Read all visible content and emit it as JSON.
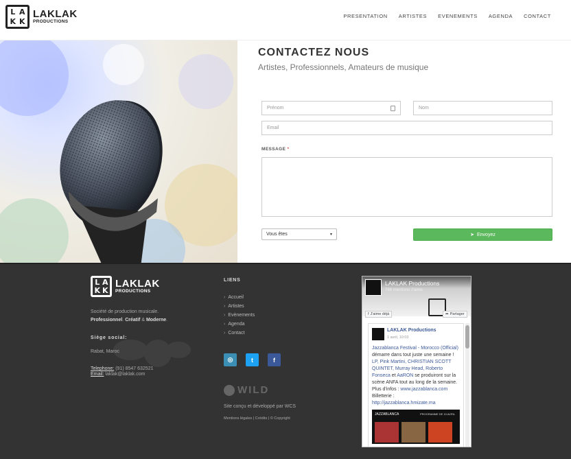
{
  "header": {
    "logo_title": "LAKLAK",
    "logo_subtitle": "PRODUCTIONS",
    "nav": [
      "PRESENTATION",
      "ARTISTES",
      "EVENEMENTS",
      "AGENDA",
      "CONTACT"
    ]
  },
  "contact": {
    "title": "CONTACTEZ NOUS",
    "subtitle": "Artistes, Professionnels, Amateurs de musique",
    "prenom_placeholder": "Prénom",
    "nom_placeholder": "Nom",
    "email_placeholder": "Email",
    "message_label": "MESSAGE",
    "message_required": "*",
    "select_value": "Vous êtes",
    "send_label": "Envoyez"
  },
  "footer": {
    "logo_title": "LAKLAK",
    "logo_subtitle": "PRODUCTIONS",
    "desc_line1": "Société de production musicale.",
    "desc_professionnel": "Professionnel",
    "desc_creatif": "Créatif",
    "desc_and": "&",
    "desc_moderne": "Moderne",
    "siege_label": "Siège social:",
    "address": "Rabat, Maroc",
    "tel_label": "Telephone:",
    "tel_value": "(91) 8547 632521",
    "email_label": "Email:",
    "email_value": "laklak@laklak.com",
    "links_title": "LIENS",
    "links": [
      "Accueil",
      "Artistes",
      "Evènements",
      "Agenda",
      "Contact"
    ],
    "credit_logo": "WILD",
    "credit": "Site conçu et développé par WCS",
    "legal": [
      "Mentions légales",
      "Crédits",
      "© Copyright"
    ]
  },
  "facebook": {
    "page_name": "LAKLAK Productions",
    "likes": "766 mentions J'aime",
    "like_button": "J'aime déjà",
    "share_button": "Partager",
    "post_author": "LAKLAK Productions",
    "post_date": "1 avril, 10:03",
    "post_text_1": "Jazzablanca Festival - Morocco (Official)",
    "post_text_2": " démarre dans tout juste une semaine ! ",
    "post_text_3": "LP, Pink Martini, CHRISTIAN SCOTT QUINTET, Murray Head, Roberto Fonseca",
    "post_text_4": " et ",
    "post_text_5": "AaRON",
    "post_text_6": " se produiront sur la scène ANFA tout au long de la semaine.",
    "post_text_7": "Plus d'infos : ",
    "post_link_1": "www.jazzablanca.com",
    "post_text_8": "Billetterie :",
    "post_link_2": "http://jazzablanca.hmizate.ma",
    "poster_brand": "JAZZABLANCA",
    "poster_text": "PROGRAMME DE 10 AVRIL"
  },
  "colors": {
    "send_button": "#5cb85c",
    "footer_bg": "#333333",
    "instagram": "#3b8fb5",
    "twitter": "#1da1f2",
    "facebook": "#3b5998"
  }
}
